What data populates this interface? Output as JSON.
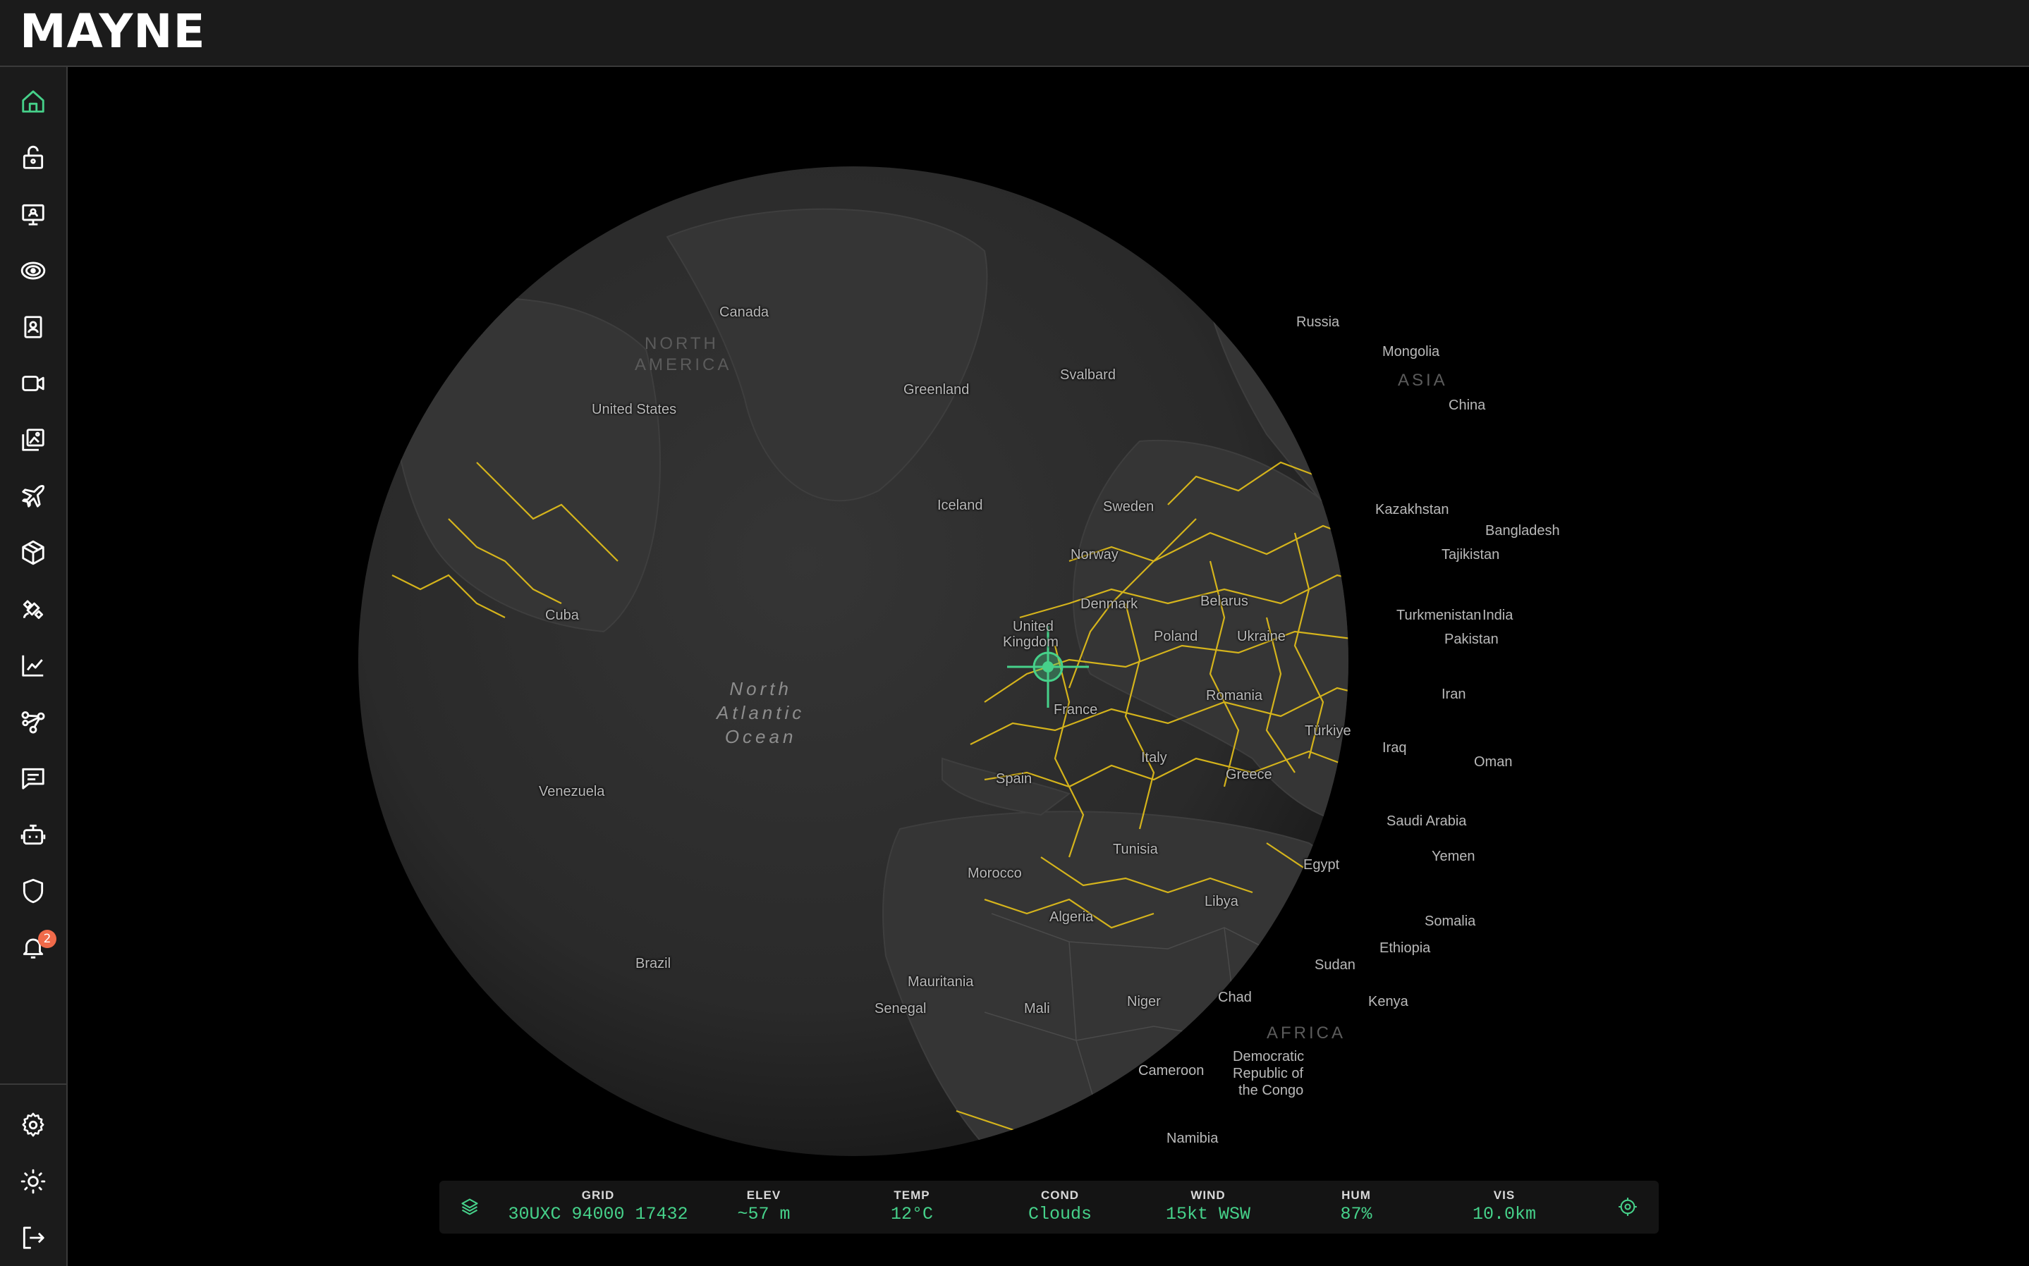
{
  "app": {
    "logo": "MAYNE"
  },
  "colors": {
    "accent": "#46d18a",
    "road": "#e7c21a",
    "badge": "#f06a4a"
  },
  "sidebar": {
    "items": [
      {
        "icon": "home-icon",
        "active": true
      },
      {
        "icon": "lock-open-icon"
      },
      {
        "icon": "monitor-icon"
      },
      {
        "icon": "radar-icon"
      },
      {
        "icon": "contact-book-icon"
      },
      {
        "icon": "video-camera-icon"
      },
      {
        "icon": "gallery-icon"
      },
      {
        "icon": "airplane-icon"
      },
      {
        "icon": "package-icon"
      },
      {
        "icon": "satellite-icon"
      },
      {
        "icon": "line-chart-icon"
      },
      {
        "icon": "network-icon"
      },
      {
        "icon": "message-icon"
      },
      {
        "icon": "bot-icon"
      },
      {
        "icon": "shield-icon"
      },
      {
        "icon": "bell-icon",
        "badge": "2"
      }
    ],
    "bottom": [
      {
        "icon": "settings-icon"
      },
      {
        "icon": "sun-icon"
      },
      {
        "icon": "logout-icon"
      }
    ]
  },
  "map": {
    "ocean_label": [
      "North",
      "Atlantic",
      "Ocean"
    ],
    "regions": [
      {
        "text": "NORTH",
        "id": "na1"
      },
      {
        "text": "AMERICA",
        "id": "na2"
      },
      {
        "text": "ASIA",
        "id": "asia"
      },
      {
        "text": "AFRICA",
        "id": "africa"
      }
    ],
    "labels": [
      "Canada",
      "United States",
      "Greenland",
      "Svalbard",
      "Russia",
      "Mongolia",
      "China",
      "Iceland",
      "Sweden",
      "Kazakhstan",
      "Bangladesh",
      "Tajikistan",
      "Norway",
      "Cuba",
      "Denmark",
      "Belarus",
      "Turkmenistan",
      "India",
      "United",
      "Kingdom",
      "Poland",
      "Ukraine",
      "Pakistan",
      "Iran",
      "France",
      "Romania",
      "Türkiye",
      "Iraq",
      "Italy",
      "Oman",
      "Spain",
      "Greece",
      "Venezuela",
      "Saudi Arabia",
      "Tunisia",
      "Yemen",
      "Egypt",
      "Morocco",
      "Libya",
      "Algeria",
      "Somalia",
      "Ethiopia",
      "Brazil",
      "Sudan",
      "Mauritania",
      "Chad",
      "Kenya",
      "Senegal",
      "Mali",
      "Niger",
      "Cameroon",
      "Democratic",
      "Republic of",
      "the Congo",
      "Namibia"
    ]
  },
  "status": {
    "grid": {
      "label": "GRID",
      "value": "30UXC 94000 17432"
    },
    "elev": {
      "label": "ELEV",
      "value": "~57 m"
    },
    "temp": {
      "label": "TEMP",
      "value": "12°C"
    },
    "cond": {
      "label": "COND",
      "value": "Clouds"
    },
    "wind": {
      "label": "WIND",
      "value": "15kt WSW"
    },
    "hum": {
      "label": "HUM",
      "value": "87%"
    },
    "vis": {
      "label": "VIS",
      "value": "10.0km"
    }
  }
}
